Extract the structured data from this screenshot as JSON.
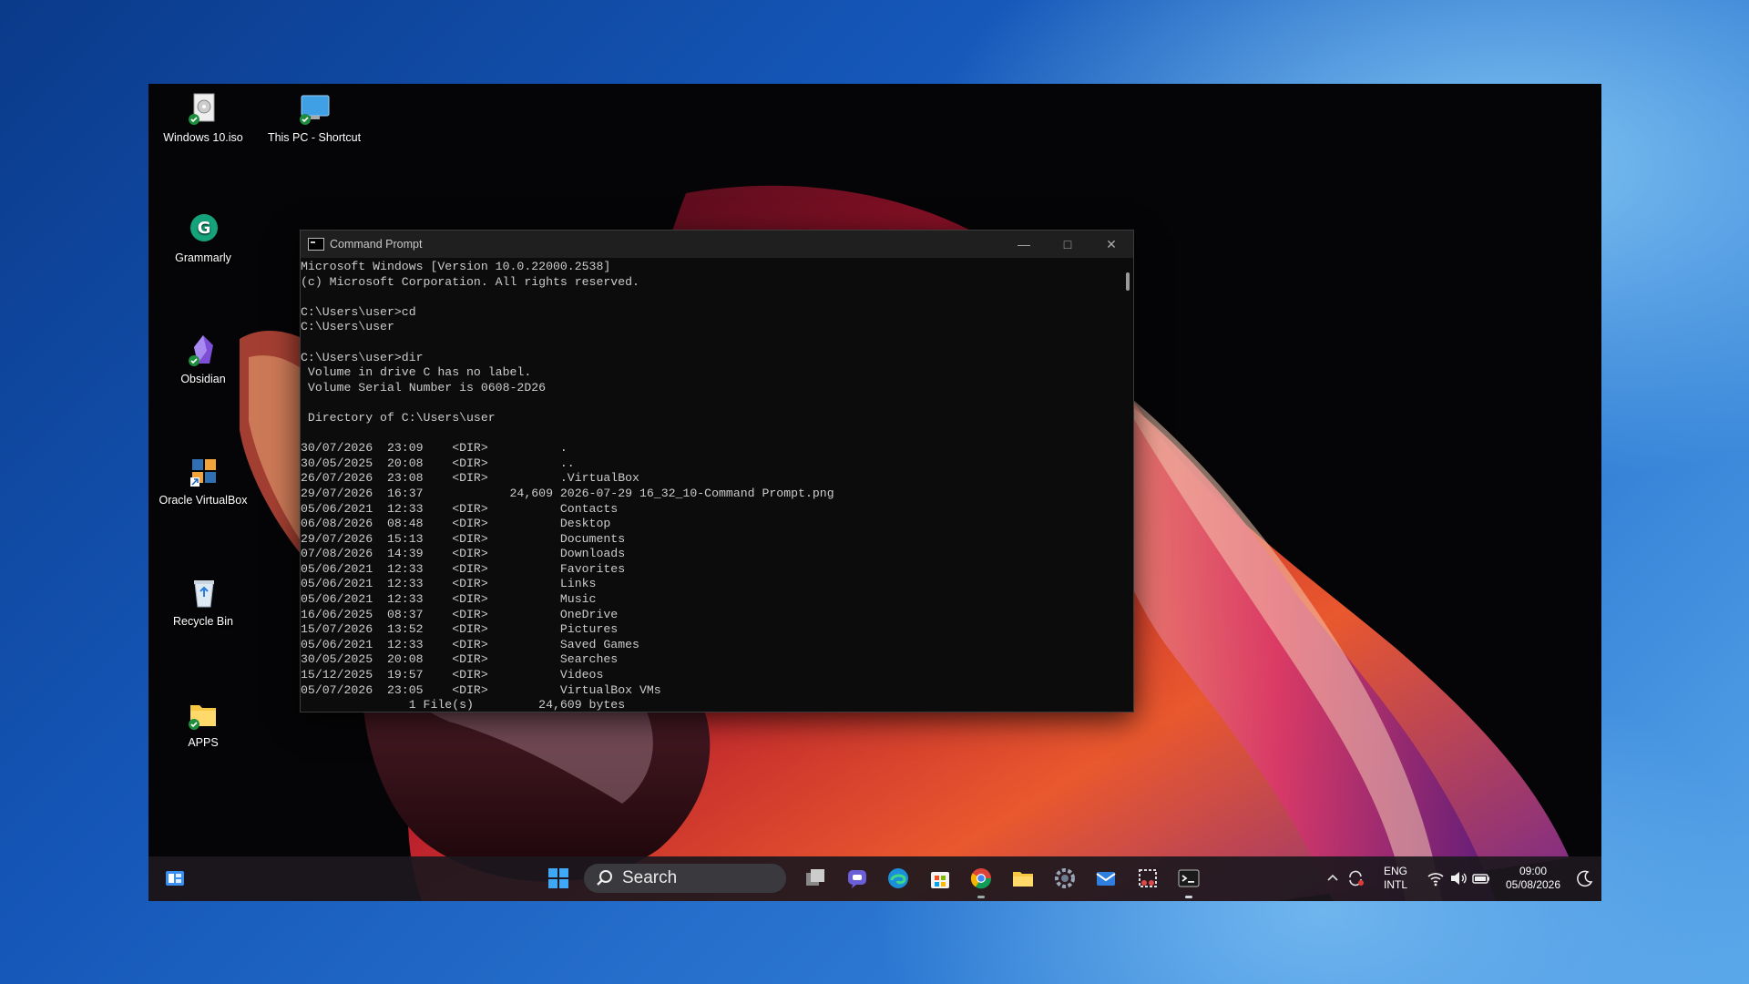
{
  "desktop": {
    "icons": [
      {
        "label": "Windows 10.iso"
      },
      {
        "label": "This PC - Shortcut"
      },
      {
        "label": "Grammarly"
      },
      {
        "label": "Obsidian"
      },
      {
        "label": "Oracle VirtualBox"
      },
      {
        "label": "Recycle Bin"
      },
      {
        "label": "APPS"
      }
    ]
  },
  "cmd": {
    "title": "Command Prompt",
    "lines": [
      "Microsoft Windows [Version 10.0.22000.2538]",
      "(c) Microsoft Corporation. All rights reserved.",
      "",
      "C:\\Users\\user>cd",
      "C:\\Users\\user",
      "",
      "C:\\Users\\user>dir",
      " Volume in drive C has no label.",
      " Volume Serial Number is 0608-2D26",
      "",
      " Directory of C:\\Users\\user",
      "",
      "30/07/2026  23:09    <DIR>          .",
      "30/05/2025  20:08    <DIR>          ..",
      "26/07/2026  23:08    <DIR>          .VirtualBox",
      "29/07/2026  16:37            24,609 2026-07-29 16_32_10-Command Prompt.png",
      "05/06/2021  12:33    <DIR>          Contacts",
      "06/08/2026  08:48    <DIR>          Desktop",
      "29/07/2026  15:13    <DIR>          Documents",
      "07/08/2026  14:39    <DIR>          Downloads",
      "05/06/2021  12:33    <DIR>          Favorites",
      "05/06/2021  12:33    <DIR>          Links",
      "05/06/2021  12:33    <DIR>          Music",
      "16/06/2025  08:37    <DIR>          OneDrive",
      "15/07/2026  13:52    <DIR>          Pictures",
      "05/06/2021  12:33    <DIR>          Saved Games",
      "30/05/2025  20:08    <DIR>          Searches",
      "15/12/2025  19:57    <DIR>          Videos",
      "05/07/2026  23:05    <DIR>          VirtualBox VMs",
      "               1 File(s)         24,609 bytes"
    ]
  },
  "taskbar": {
    "search_label": "Search",
    "apps": [
      "start-icon",
      "task-view-icon",
      "teams-chat-icon",
      "edge-icon",
      "store-icon",
      "chrome-icon",
      "file-explorer-icon",
      "settings-icon",
      "mail-icon",
      "snipping-tool-icon",
      "terminal-icon"
    ],
    "tray": {
      "lang_top": "ENG",
      "lang_bottom": "INTL",
      "time": "09:00",
      "date": "05/08/2026"
    }
  }
}
